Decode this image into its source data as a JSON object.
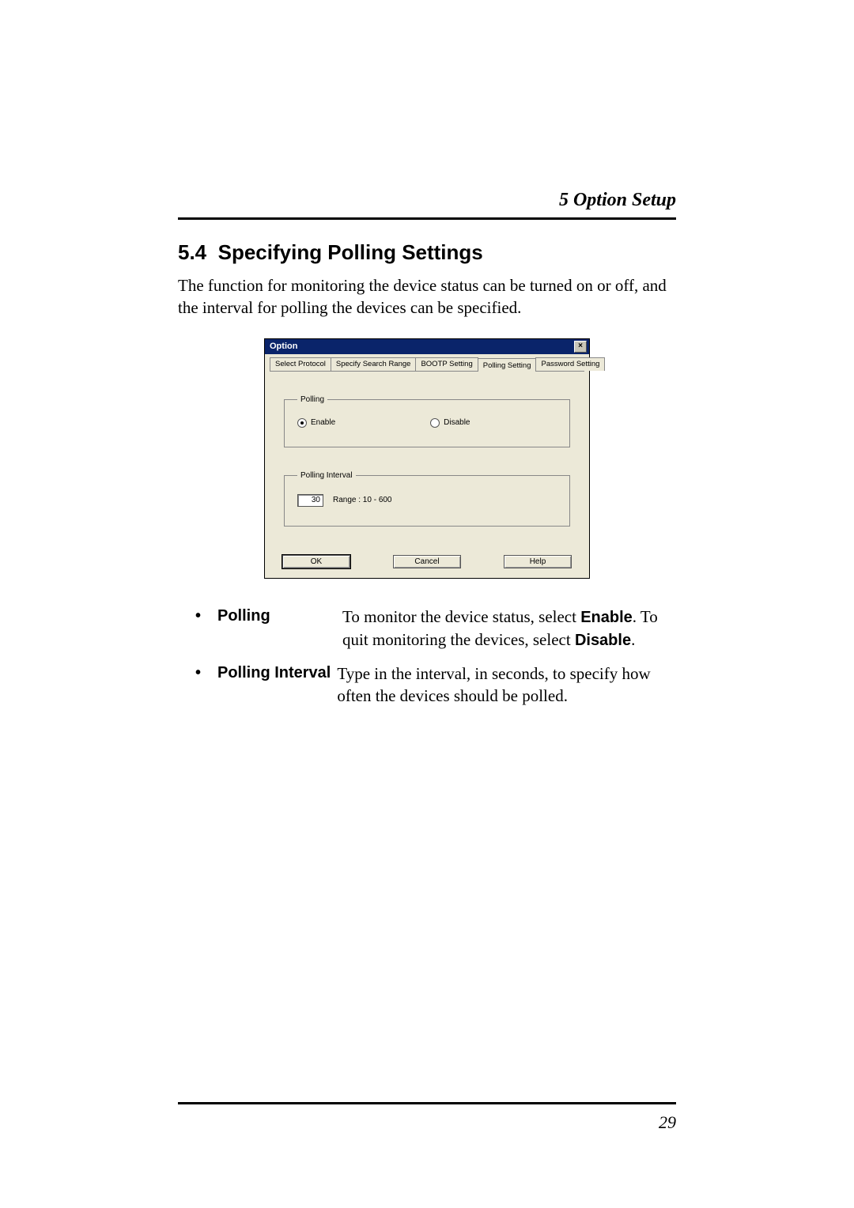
{
  "header": {
    "running_head": "5  Option Setup"
  },
  "section": {
    "number": "5.4",
    "title": "Specifying Polling Settings",
    "intro": "The function for monitoring the device status can be turned on or off, and the interval for polling the devices can be specified."
  },
  "dialog": {
    "title": "Option",
    "close": "×",
    "tabs": {
      "t0": "Select Protocol",
      "t1": "Specify Search Range",
      "t2": "BOOTP Setting",
      "t3": "Polling Setting",
      "t4": "Password Setting"
    },
    "polling_group": {
      "legend": "Polling",
      "enable": "Enable",
      "disable": "Disable"
    },
    "interval_group": {
      "legend": "Polling Interval",
      "value": "30",
      "range": "Range : 10 - 600"
    },
    "buttons": {
      "ok": "OK",
      "cancel": "Cancel",
      "help": "Help"
    }
  },
  "defs": {
    "bullet": "•",
    "polling": {
      "term": "Polling",
      "desc_pre": "To monitor the device status, select ",
      "enable": "Enable",
      "desc_mid": ". To quit monitoring the devices, select ",
      "disable": "Disable",
      "desc_post": "."
    },
    "interval": {
      "term": "Polling Interval",
      "desc": "Type in the interval, in seconds, to specify how often the devices should be polled."
    }
  },
  "footer": {
    "page": "29"
  }
}
